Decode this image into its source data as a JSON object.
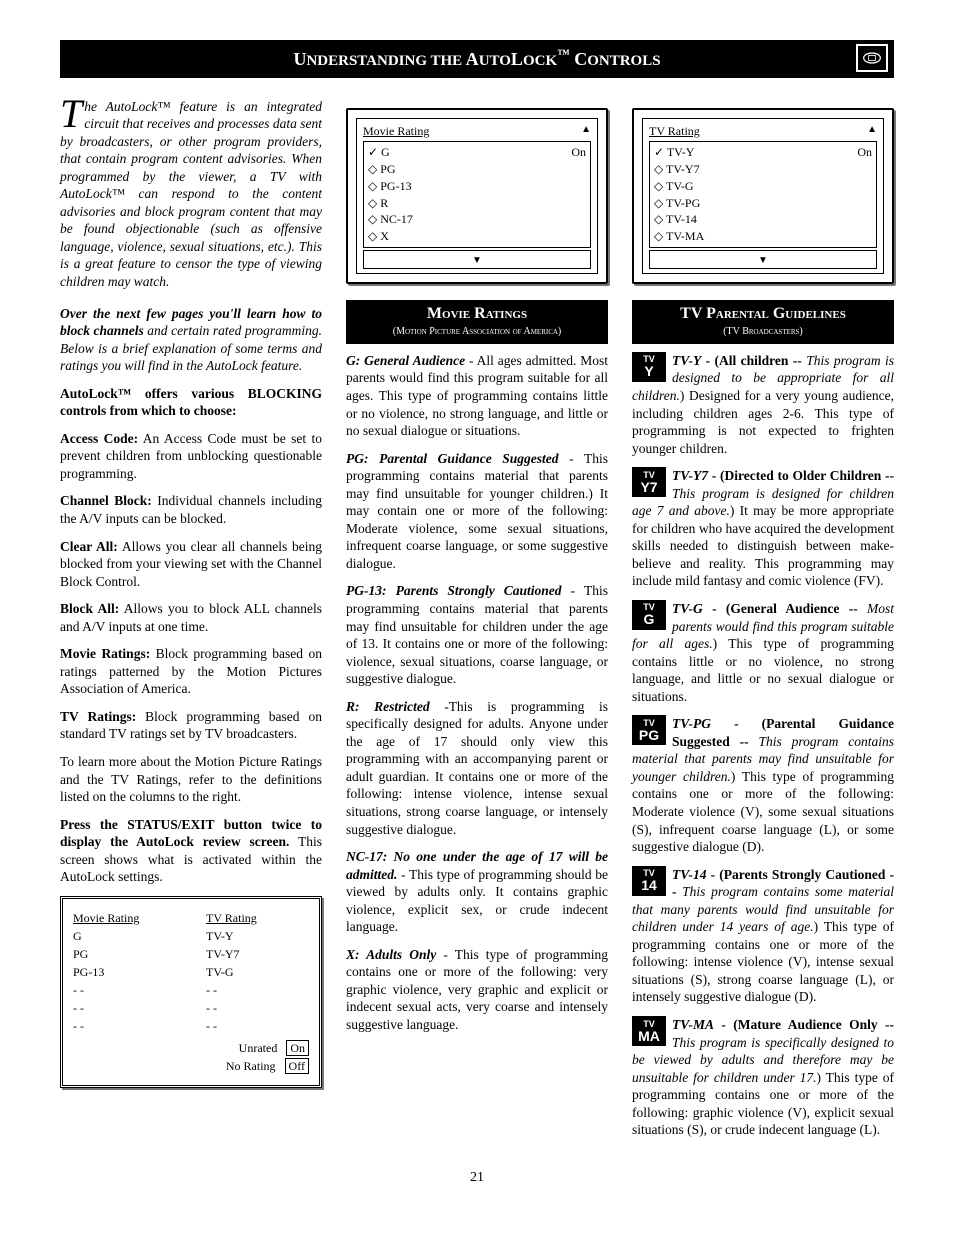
{
  "header": {
    "title_html": "Understanding the AutoLock™ Controls"
  },
  "col1": {
    "intro": "he AutoLock™ feature is an integrated circuit that receives and processes data sent by broadcasters, or other program providers, that contain program content advisories. When programmed by the viewer, a TV with AutoLock™ can respond to the content advisories and block program content that may be found objectionable (such as offensive language, violence, sexual situations, etc.). This is a great feature to censor the type of viewing children may watch.",
    "lead": "Over the next few pages you'll learn how to block channels",
    "lead_rest": " and certain rated programming. Below is a brief explanation of some terms and ratings you will find in the AutoLock feature.",
    "blocking_head": "AutoLock™ offers various BLOCKING controls from which to choose:",
    "access_code_t": "Access Code:",
    "access_code": " An Access Code must be set to prevent children from unblocking questionable programming.",
    "channel_block_t": "Channel Block:",
    "channel_block": " Individual channels including the A/V inputs can be blocked.",
    "clear_all_t": "Clear All:",
    "clear_all": " Allows you clear all channels being blocked from your viewing set with the Channel Block Control.",
    "block_all_t": "Block All:",
    "block_all": " Allows you to block ALL channels and A/V inputs at one time.",
    "movie_ratings_t": "Movie Ratings:",
    "movie_ratings": " Block programming based on ratings patterned by the Motion Pictures Association of America.",
    "tv_ratings_t": "TV Ratings:",
    "tv_ratings": " Block programming based on standard TV ratings set by TV broadcasters.",
    "learn_more": "To learn more about the Motion Picture Ratings and the TV Ratings, refer to the definitions listed on the columns to the right.",
    "press_head": "Press the STATUS/EXIT button twice to display the AutoLock review screen.",
    "press_rest": " This screen shows what is activated within the AutoLock settings.",
    "review": {
      "movie_head": "Movie Rating",
      "tv_head": "TV Rating",
      "movie_rows": [
        "G",
        "PG",
        "PG-13",
        "- -",
        "- -",
        "- -"
      ],
      "tv_rows": [
        "TV-Y",
        "TV-Y7",
        "TV-G",
        "- -",
        "- -",
        "- -"
      ],
      "unrated": "Unrated",
      "norating": "No Rating",
      "on": "On",
      "off": "Off"
    }
  },
  "col2": {
    "osd_title": "Movie Rating",
    "osd_rows": [
      {
        "l": "✓ G",
        "r": "On"
      },
      {
        "l": "◇ PG",
        "r": ""
      },
      {
        "l": "◇ PG-13",
        "r": ""
      },
      {
        "l": "◇ R",
        "r": ""
      },
      {
        "l": "◇ NC-17",
        "r": ""
      },
      {
        "l": "◇ X",
        "r": ""
      }
    ],
    "section_t": "Movie Ratings",
    "section_s": "(Motion Picture Association of America)",
    "g_t": "G: General Audience",
    "g": " - All ages admitted. Most parents would find this program suitable for all ages. This type of programming contains little or no violence, no strong language, and little or no sexual dialogue or situations.",
    "pg_t": "PG: Parental Guidance Suggested",
    "pg": " - This programming contains material that parents may find unsuitable for younger children.) It may contain one or more of the following: Moderate violence, some sexual situations, infrequent coarse language, or some suggestive dialogue.",
    "pg13_t": "PG-13: Parents Strongly Cautioned",
    "pg13": " - This programming contains material that parents may find unsuitable for children under the age of 13. It contains one or more of the following: violence, sexual situations, coarse language, or suggestive dialogue.",
    "r_t": "R: Restricted",
    "r": " -This is programming is specifically designed for adults. Anyone under the age of 17 should only view this programming with an accompanying parent or adult guardian. It contains one or more of the following: intense violence, intense sexual situations, strong coarse language, or intensely suggestive dialogue.",
    "nc17_t": "NC-17: No one under the age of 17 will be admitted.",
    "nc17": " - This type of programming should be viewed by adults only. It contains graphic violence, explicit sex, or crude indecent language.",
    "x_t": "X: Adults Only",
    "x": " - This type of programming contains one or more of the following: very graphic violence, very graphic and explicit or indecent sexual acts, very coarse and intensely suggestive language."
  },
  "col3": {
    "osd_title": "TV Rating",
    "osd_rows": [
      {
        "l": "✓ TV-Y",
        "r": "On"
      },
      {
        "l": "◇ TV-Y7",
        "r": ""
      },
      {
        "l": "◇ TV-G",
        "r": ""
      },
      {
        "l": "◇ TV-PG",
        "r": ""
      },
      {
        "l": "◇ TV-14",
        "r": ""
      },
      {
        "l": "◇ TV-MA",
        "r": ""
      }
    ],
    "section_t": "TV Parental Guidelines",
    "section_s": "(TV Broadcasters)",
    "tvy_t": "TV-Y",
    "tvy_b": " - (All children -- ",
    "tvy_i": "This program is designed to be appropriate for all children.",
    "tvy_r": ") Designed for a very young audience, including children ages 2-6. This type of programming is not expected to frighten younger children.",
    "tvy7_t": "TV-Y7",
    "tvy7_b": " - (Directed to Older Children -- ",
    "tvy7_i": "This program is designed for children age 7 and above.",
    "tvy7_r": ") It may be more appropriate for children who have acquired the development skills needed to distinguish between make-believe and reality. This programming may include mild fantasy and comic violence (FV).",
    "tvg_t": "TV-G",
    "tvg_b": " - (General Audience -- ",
    "tvg_i": "Most parents would find this program suitable for all ages.",
    "tvg_r": ") This type of programming contains little or no violence, no strong language, and little or no sexual dialogue or situations.",
    "tvpg_t": "TV-PG",
    "tvpg_b": " - (Parental Guidance Suggested -- ",
    "tvpg_i": "This program contains material that parents may find unsuitable for younger children.",
    "tvpg_r": ") This type of programming contains one or more of the following: Moderate violence (V), some sexual situations (S), infrequent coarse language (L), or some suggestive dialogue (D).",
    "tv14_t": "TV-14",
    "tv14_b": " - (Parents Strongly Cautioned -- ",
    "tv14_i": "This program contains some material that many parents would find unsuitable for children under 14 years of age.",
    "tv14_r": ") This type of programming contains one or more of the following: intense violence (V), intense sexual situations (S), strong coarse language (L), or intensely suggestive dialogue (D).",
    "tvma_t": "TV-MA",
    "tvma_b": " - (Mature Audience Only -- ",
    "tvma_i": "This program is specifically designed to be viewed by adults and therefore may be unsuitable for children under 17.",
    "tvma_r": ") This type of programming contains one or more of the following: graphic violence (V), explicit sexual situations (S), or crude indecent language (L)."
  },
  "pagenum": "21"
}
